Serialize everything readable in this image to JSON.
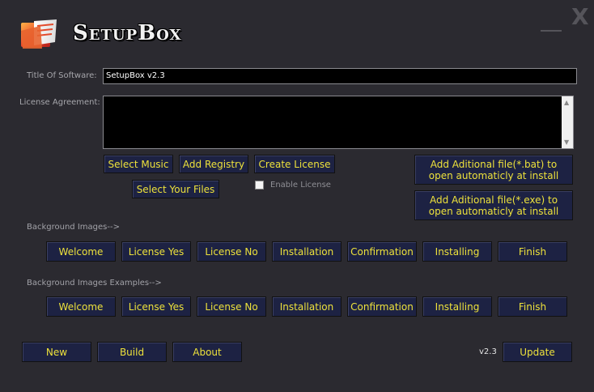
{
  "app": {
    "title": "SetupBox",
    "version": "v2.3"
  },
  "window": {
    "close_glyph": "X"
  },
  "form": {
    "title_label": "Title Of Software:",
    "title_value": "SetupBox v2.3",
    "license_label": "License Agreement:",
    "license_value": ""
  },
  "actions": {
    "select_music": "Select Music",
    "add_registry": "Add Registry",
    "create_license": "Create License",
    "select_your_files": "Select Your Files",
    "enable_license": "Enable License",
    "add_bat": "Add Aditional file(*.bat) to open automaticly at install",
    "add_exe": "Add Aditional file(*.exe) to open automaticly at install"
  },
  "background_images": {
    "label": "Background Images-->",
    "buttons": [
      "Welcome",
      "License Yes",
      "License No",
      "Installation",
      "Confirmation",
      "Installing",
      "Finish"
    ]
  },
  "background_examples": {
    "label": "Background Images Examples-->",
    "buttons": [
      "Welcome",
      "License Yes",
      "License No",
      "Installation",
      "Confirmation",
      "Installing",
      "Finish"
    ]
  },
  "footer": {
    "new": "New",
    "build": "Build",
    "about": "About",
    "version": "v2.3",
    "update": "Update"
  },
  "colors": {
    "background": "#2b2a30",
    "button_bg": "#1d2243",
    "button_text": "#ede13b"
  },
  "icons": {
    "logo": "folder-logo-icon",
    "minimize": "minimize-icon",
    "close": "close-icon"
  }
}
